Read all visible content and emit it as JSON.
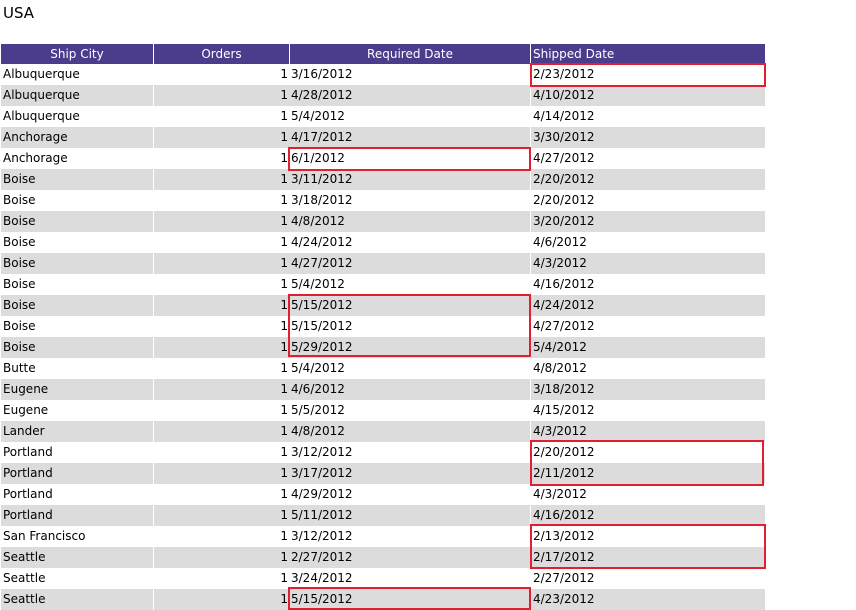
{
  "page": {
    "title": "USA"
  },
  "table": {
    "headers": {
      "ship_city": "Ship City",
      "orders": "Orders",
      "required_date": "Required Date",
      "shipped_date": "Shipped Date"
    },
    "header_color": "#4b3c8c",
    "alt_row_color": "#dcdcdc",
    "highlight_color": "#e02030",
    "rows": [
      {
        "city": "Albuquerque",
        "orders": "1",
        "required": "3/16/2012",
        "shipped": "2/23/2012"
      },
      {
        "city": "Albuquerque",
        "orders": "1",
        "required": "4/28/2012",
        "shipped": "4/10/2012"
      },
      {
        "city": "Albuquerque",
        "orders": "1",
        "required": "5/4/2012",
        "shipped": "4/14/2012"
      },
      {
        "city": "Anchorage",
        "orders": "1",
        "required": "4/17/2012",
        "shipped": "3/30/2012"
      },
      {
        "city": "Anchorage",
        "orders": "1",
        "required": "6/1/2012",
        "shipped": "4/27/2012"
      },
      {
        "city": "Boise",
        "orders": "1",
        "required": "3/11/2012",
        "shipped": "2/20/2012"
      },
      {
        "city": "Boise",
        "orders": "1",
        "required": "3/18/2012",
        "shipped": "2/20/2012"
      },
      {
        "city": "Boise",
        "orders": "1",
        "required": "4/8/2012",
        "shipped": "3/20/2012"
      },
      {
        "city": "Boise",
        "orders": "1",
        "required": "4/24/2012",
        "shipped": "4/6/2012"
      },
      {
        "city": "Boise",
        "orders": "1",
        "required": "4/27/2012",
        "shipped": "4/3/2012"
      },
      {
        "city": "Boise",
        "orders": "1",
        "required": "5/4/2012",
        "shipped": "4/16/2012"
      },
      {
        "city": "Boise",
        "orders": "1",
        "required": "5/15/2012",
        "shipped": "4/24/2012"
      },
      {
        "city": "Boise",
        "orders": "1",
        "required": "5/15/2012",
        "shipped": "4/27/2012"
      },
      {
        "city": "Boise",
        "orders": "1",
        "required": "5/29/2012",
        "shipped": "5/4/2012"
      },
      {
        "city": "Butte",
        "orders": "1",
        "required": "5/4/2012",
        "shipped": "4/8/2012"
      },
      {
        "city": "Eugene",
        "orders": "1",
        "required": "4/6/2012",
        "shipped": "3/18/2012"
      },
      {
        "city": "Eugene",
        "orders": "1",
        "required": "5/5/2012",
        "shipped": "4/15/2012"
      },
      {
        "city": "Lander",
        "orders": "1",
        "required": "4/8/2012",
        "shipped": "4/3/2012"
      },
      {
        "city": "Portland",
        "orders": "1",
        "required": "3/12/2012",
        "shipped": "2/20/2012"
      },
      {
        "city": "Portland",
        "orders": "1",
        "required": "3/17/2012",
        "shipped": "2/11/2012"
      },
      {
        "city": "Portland",
        "orders": "1",
        "required": "4/29/2012",
        "shipped": "4/3/2012"
      },
      {
        "city": "Portland",
        "orders": "1",
        "required": "5/11/2012",
        "shipped": "4/16/2012"
      },
      {
        "city": "San Francisco",
        "orders": "1",
        "required": "3/12/2012",
        "shipped": "2/13/2012"
      },
      {
        "city": "Seattle",
        "orders": "1",
        "required": "2/27/2012",
        "shipped": "2/17/2012"
      },
      {
        "city": "Seattle",
        "orders": "1",
        "required": "3/24/2012",
        "shipped": "2/27/2012"
      },
      {
        "city": "Seattle",
        "orders": "1",
        "required": "5/15/2012",
        "shipped": "4/23/2012"
      }
    ]
  }
}
